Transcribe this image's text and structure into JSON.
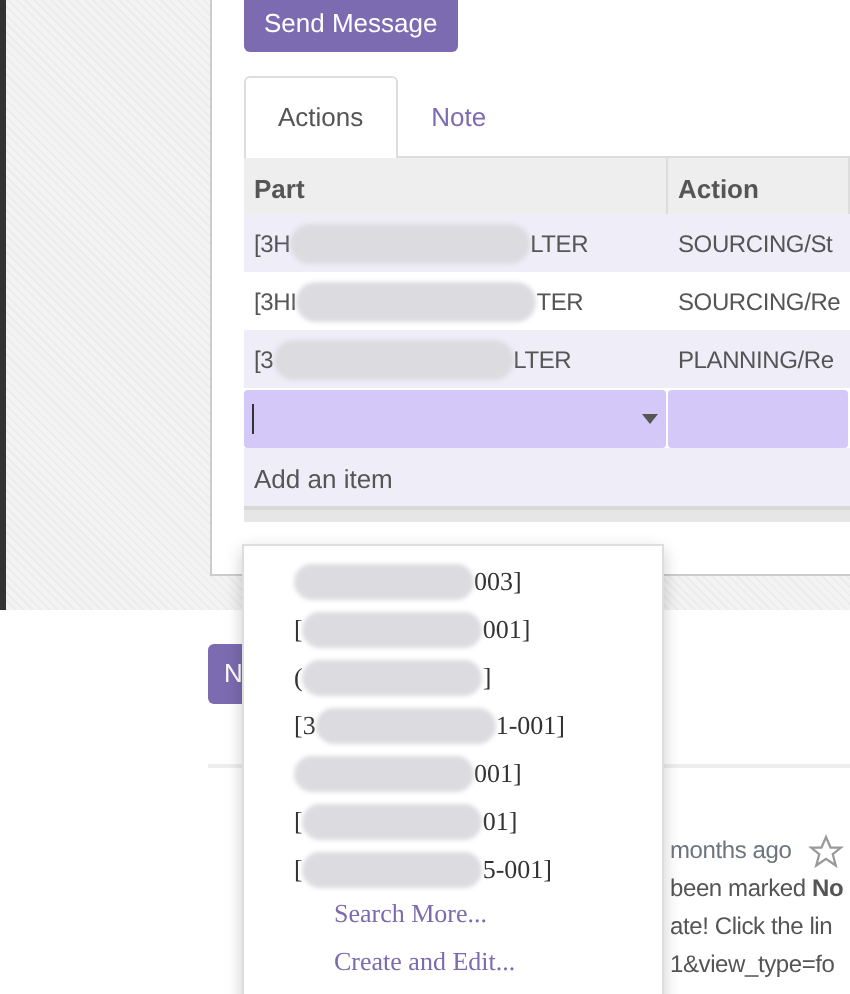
{
  "send_button": "Send Message",
  "tabs": [
    {
      "label": "Actions",
      "selected": true
    },
    {
      "label": "Note",
      "selected": false
    }
  ],
  "table": {
    "columns": [
      "Part",
      "Action"
    ],
    "rows": [
      {
        "part_prefix": "[3H",
        "part_suffix": "LTER",
        "action": "SOURCING/St"
      },
      {
        "part_prefix": "[3HI",
        "part_suffix": "TER",
        "action": "SOURCING/Re"
      },
      {
        "part_prefix": "[3",
        "part_suffix": "LTER",
        "action": "PLANNING/Re"
      }
    ],
    "add_item": "Add an item"
  },
  "background_button": "N",
  "message": {
    "time": "months ago",
    "starred": false,
    "line_1_prefix": "been marked ",
    "line_1_bold": "No",
    "line_2": "ate! Click the lin",
    "link": "1&view_type=fo"
  },
  "dropdown": {
    "items": [
      {
        "suffix": "003]"
      },
      {
        "prefix": "[",
        "suffix": "001]"
      },
      {
        "prefix": "(",
        "suffix": "]"
      },
      {
        "prefix": "[3",
        "suffix": "1-001]"
      },
      {
        "suffix": "001]"
      },
      {
        "prefix": "[",
        "suffix": "01]"
      },
      {
        "prefix": "[",
        "suffix": "5-001]"
      }
    ],
    "actions": [
      "Search More...",
      "Create and Edit..."
    ]
  }
}
